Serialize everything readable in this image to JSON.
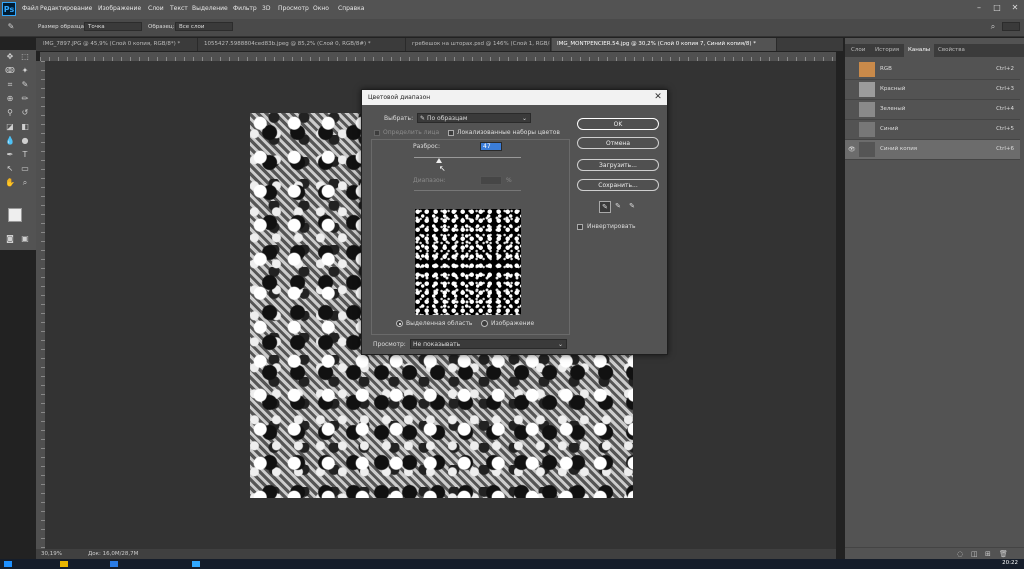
{
  "app": {
    "logo": "Ps"
  },
  "menu": [
    "Файл",
    "Редактирование",
    "Изображение",
    "Слои",
    "Текст",
    "Выделение",
    "Фильтр",
    "3D",
    "Просмотр",
    "Окно",
    "Справка"
  ],
  "options_bar": {
    "sample_size_label": "Размер образца:",
    "sample_size_value": "Точка",
    "sample_label": "Образец:",
    "sample_value": "Все слои"
  },
  "tabs": [
    {
      "label": "IMG_7897.JPG @ 45,9% (Слой 0 копия, RGB/8*) *",
      "active": false
    },
    {
      "label": "1055427.5988804ced83b.jpeg @ 85,2% (Слой 0, RGB/8#) *",
      "active": false
    },
    {
      "label": "гребешок на шторах.psd @ 146% (Слой 1, RGB/8#) *",
      "active": false
    },
    {
      "label": "IMG_MONTPENCIER.54.jpg @ 30,2% (Слой 0 копия 7, Синий копия/8) *",
      "active": true
    }
  ],
  "status": {
    "zoom": "30,19%",
    "doc": "Док: 16,0M/28,7M"
  },
  "panel_tabs": [
    {
      "label": "Слои",
      "active": false
    },
    {
      "label": "История",
      "active": false
    },
    {
      "label": "Каналы",
      "active": true
    },
    {
      "label": "Свойства",
      "active": false
    }
  ],
  "channels": [
    {
      "name": "RGB",
      "shortcut": "Ctrl+2",
      "selected": false,
      "thumb": "#c98a4a"
    },
    {
      "name": "Красный",
      "shortcut": "Ctrl+3",
      "selected": false,
      "thumb": "#9c9c9c"
    },
    {
      "name": "Зеленый",
      "shortcut": "Ctrl+4",
      "selected": false,
      "thumb": "#8a8a8a"
    },
    {
      "name": "Синий",
      "shortcut": "Ctrl+5",
      "selected": false,
      "thumb": "#777777"
    },
    {
      "name": "Синий копия",
      "shortcut": "Ctrl+6",
      "selected": true,
      "thumb": "#555555"
    }
  ],
  "dialog": {
    "title": "Цветовой диапазон",
    "select_label": "Выбрать:",
    "select_value": "По образцам",
    "detect_faces": "Определить лица",
    "localized": "Локализованные наборы цветов",
    "fuzziness_label": "Разброс:",
    "fuzziness_value": "47",
    "range_label": "Диапазон:",
    "range_unit": "%",
    "radio_selection": "Выделенная область",
    "radio_image": "Изображение",
    "preview_label": "Просмотр:",
    "preview_value": "Не показывать",
    "ok": "OK",
    "cancel": "Отмена",
    "load": "Загрузить...",
    "save": "Сохранить...",
    "invert": "Инвертировать"
  },
  "clock": "20:22"
}
